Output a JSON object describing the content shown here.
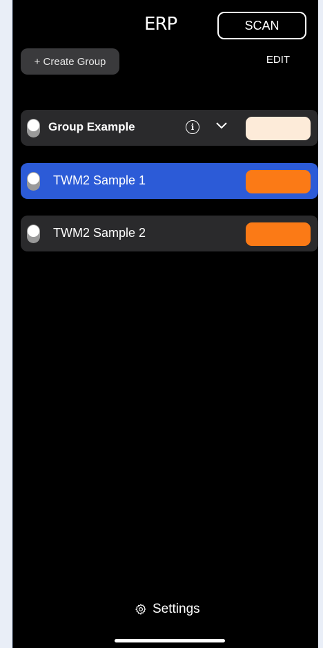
{
  "header": {
    "logo_text": "ERP",
    "scan_label": "SCAN"
  },
  "toolbar": {
    "create_group_label": "+ Create Group",
    "edit_label": "EDIT"
  },
  "rows": [
    {
      "label": "Group Example",
      "type": "group",
      "selected": false,
      "color": "#fdebd9",
      "info_icon": "info-icon",
      "expand_icon": "chevron-down-icon"
    },
    {
      "label": "TWM2 Sample 1",
      "type": "device",
      "selected": true,
      "color": "#fb7a16"
    },
    {
      "label": "TWM2 Sample 2",
      "type": "device",
      "selected": false,
      "color": "#fb7a16"
    }
  ],
  "footer": {
    "settings_label": "Settings",
    "settings_icon": "gear-icon"
  },
  "colors": {
    "background": "#000000",
    "selected_row": "#2c5bd7",
    "row_bg": "#2a2a2c",
    "button_bg": "#3a3a3c"
  }
}
